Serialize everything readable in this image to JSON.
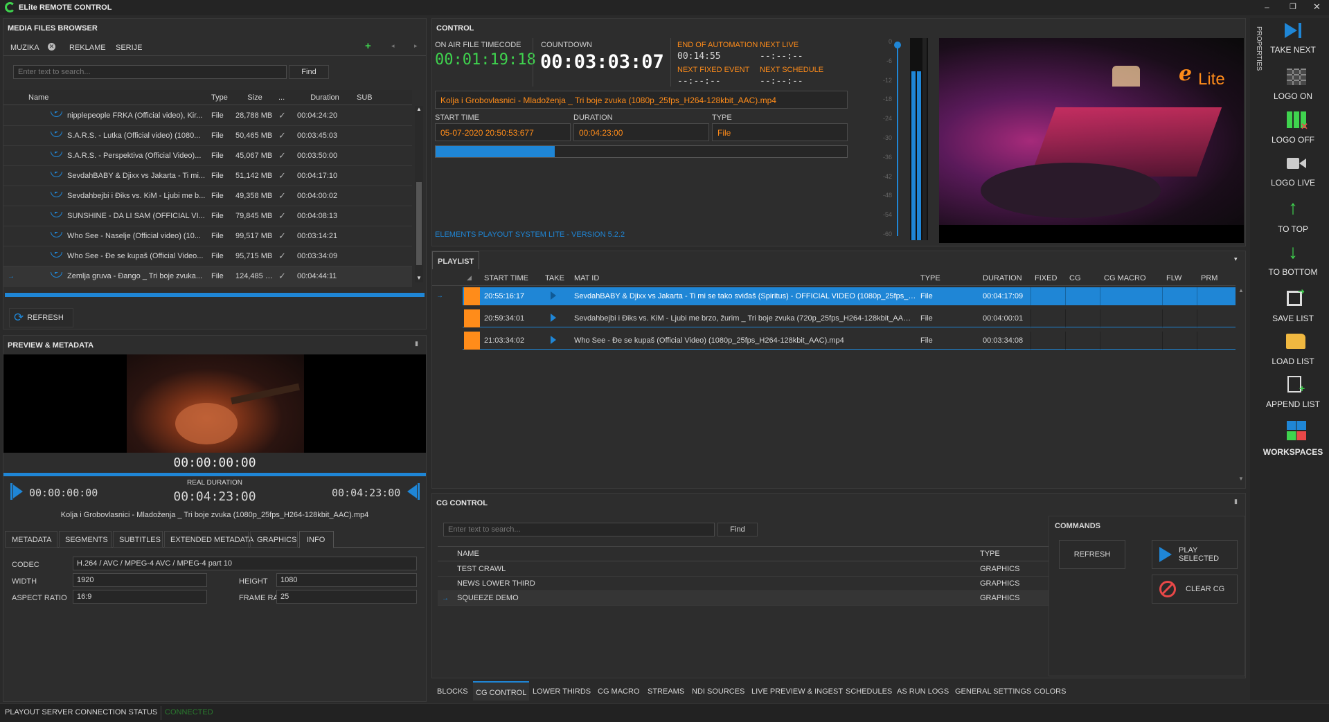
{
  "app": {
    "title": "ELite REMOTE CONTROL"
  },
  "colors": {
    "accent": "#1f86d6",
    "orange": "#ff8c1a",
    "green": "#3fd34e",
    "bg": "#2a2a2a"
  },
  "media": {
    "header": "MEDIA FILES BROWSER",
    "tabs": [
      "MUZIKA",
      "REKLAME",
      "SERIJE"
    ],
    "search_placeholder": "Enter text to search...",
    "find": "Find",
    "cols": [
      "Name",
      "Type",
      "Size",
      "...",
      "Duration",
      "SUB"
    ],
    "rows": [
      {
        "name": "nipplepeople FRKA (Official video), Kir...",
        "type": "File",
        "size": "28,788 MB",
        "duration": "00:04:24:20"
      },
      {
        "name": "S.A.R.S. - Lutka (Official video) (1080...",
        "type": "File",
        "size": "50,465 MB",
        "duration": "00:03:45:03"
      },
      {
        "name": "S.A.R.S. - Perspektiva (Official Video)...",
        "type": "File",
        "size": "45,067 MB",
        "duration": "00:03:50:00"
      },
      {
        "name": "SevdahBABY & Djixx vs Jakarta - Ti mi...",
        "type": "File",
        "size": "51,142 MB",
        "duration": "00:04:17:10"
      },
      {
        "name": "Sevdahbejbi i Ðiks vs. KiM - Ljubi me b...",
        "type": "File",
        "size": "49,358 MB",
        "duration": "00:04:00:02"
      },
      {
        "name": "SUNSHINE - DA LI SAM (OFFICIAL VI...",
        "type": "File",
        "size": "79,845 MB",
        "duration": "00:04:08:13"
      },
      {
        "name": "Who See - Naselje (Official video) (10...",
        "type": "File",
        "size": "99,517 MB",
        "duration": "00:03:14:21"
      },
      {
        "name": "Who See - Đe se kupaš (Official Video...",
        "type": "File",
        "size": "95,715 MB",
        "duration": "00:03:34:09"
      },
      {
        "name": "Zemlja gruva - Đango _ Tri boje zvuka...",
        "type": "File",
        "size": "124,485 MB",
        "duration": "00:04:44:11"
      }
    ],
    "refresh": "REFRESH"
  },
  "preview": {
    "header": "PREVIEW & METADATA",
    "timecode": "00:00:00:00",
    "real_duration_label": "REAL DURATION",
    "in_tc": "00:00:00:00",
    "real_duration": "00:04:23:00",
    "out_tc": "00:04:23:00",
    "filename": "Kolja i Grobovlasnici - Mladoženja _ Tri boje zvuka (1080p_25fps_H264-128kbit_AAC).mp4",
    "tabs": [
      "METADATA",
      "SEGMENTS",
      "SUBTITLES",
      "EXTENDED METADATA",
      "GRAPHICS",
      "INFO"
    ],
    "codec_label": "CODEC",
    "codec": "H.264 / AVC / MPEG-4 AVC / MPEG-4 part 10",
    "width_label": "WIDTH",
    "width": "1920",
    "height_label": "HEIGHT",
    "height": "1080",
    "aspect_label": "ASPECT RATIO",
    "aspect": "16:9",
    "fps_label": "FRAME RATE",
    "fps": "25"
  },
  "control": {
    "header": "CONTROL",
    "on_air_label": "ON AIR FILE TIMECODE",
    "on_air_tc": "00:01:19:18",
    "countdown_label": "COUNTDOWN",
    "countdown": "00:03:03:07",
    "eoa_label": "END OF AUTOMATION",
    "eoa": "00:14:55",
    "next_live_label": "NEXT LIVE",
    "next_live": "--:--:--",
    "next_fixed_label": "NEXT FIXED EVENT",
    "next_fixed": "--:--:--",
    "next_schedule_label": "NEXT SCHEDULE",
    "next_schedule": "--:--:--",
    "current_file": "Kolja i Grobovlasnici - Mladoženja _ Tri boje zvuka (1080p_25fps_H264-128kbit_AAC).mp4",
    "start_label": "START TIME",
    "start": "05-07-2020 20:50:53:677",
    "duration_label": "DURATION",
    "duration": "00:04:23:00",
    "type_label": "TYPE",
    "type": "File",
    "progress": 0.29,
    "version": "ELEMENTS PLAYOUT SYSTEM LITE - VERSION 5.2.2",
    "meter_ticks": [
      "0",
      "-6",
      "-12",
      "-18",
      "-24",
      "-30",
      "-36",
      "-42",
      "-48",
      "-54",
      "-60"
    ],
    "logo_text": "Lite"
  },
  "playlist": {
    "header": "PLAYLIST",
    "cols": [
      "START TIME",
      "TAKE",
      "MAT ID",
      "TYPE",
      "DURATION",
      "FIXED",
      "CG",
      "CG MACRO",
      "FLW",
      "PRM"
    ],
    "rows": [
      {
        "start": "20:55:16:17",
        "mat": "SevdahBABY & Djixx vs Jakarta - Ti mi se tako sviđaš (Spiritus) - OFFICIAL VIDEO (1080p_25fps_H...",
        "type": "File",
        "duration": "00:04:17:09"
      },
      {
        "start": "20:59:34:01",
        "mat": "Sevdahbejbi i Ðiks vs. KiM - Ljubi me brzo, žurim _ Tri boje zvuka (720p_25fps_H264-128kbit_AAC)....",
        "type": "File",
        "duration": "00:04:00:01"
      },
      {
        "start": "21:03:34:02",
        "mat": "Who See - Đe se kupaš (Official Video) (1080p_25fps_H264-128kbit_AAC).mp4",
        "type": "File",
        "duration": "00:03:34:08"
      }
    ]
  },
  "cg": {
    "header": "CG CONTROL",
    "search_placeholder": "Enter text to search...",
    "find": "Find",
    "cols": [
      "NAME",
      "TYPE"
    ],
    "rows": [
      {
        "name": "TEST CRAWL",
        "type": "GRAPHICS"
      },
      {
        "name": "NEWS LOWER THIRD",
        "type": "GRAPHICS"
      },
      {
        "name": "SQUEEZE DEMO",
        "type": "GRAPHICS"
      }
    ]
  },
  "commands": {
    "header": "COMMANDS",
    "refresh": "REFRESH",
    "play_selected": "PLAY SELECTED",
    "clear_cg": "CLEAR CG"
  },
  "bottom_tabs": [
    "BLOCKS",
    "CG CONTROL",
    "LOWER THIRDS",
    "CG MACRO",
    "STREAMS",
    "NDI SOURCES",
    "LIVE PREVIEW & INGEST",
    "SCHEDULES",
    "AS RUN LOGS",
    "GENERAL SETTINGS",
    "COLORS"
  ],
  "right": {
    "properties": "PROPERTIES",
    "take_next": "TAKE NEXT",
    "logo_on": "LOGO ON",
    "logo_off": "LOGO OFF",
    "logo_live": "LOGO LIVE",
    "to_top": "TO TOP",
    "to_bottom": "TO BOTTOM",
    "save_list": "SAVE LIST",
    "load_list": "LOAD LIST",
    "append_list": "APPEND LIST",
    "workspaces": "WORKSPACES"
  },
  "status": {
    "label": "PLAYOUT SERVER CONNECTION STATUS",
    "value": "CONNECTED"
  }
}
